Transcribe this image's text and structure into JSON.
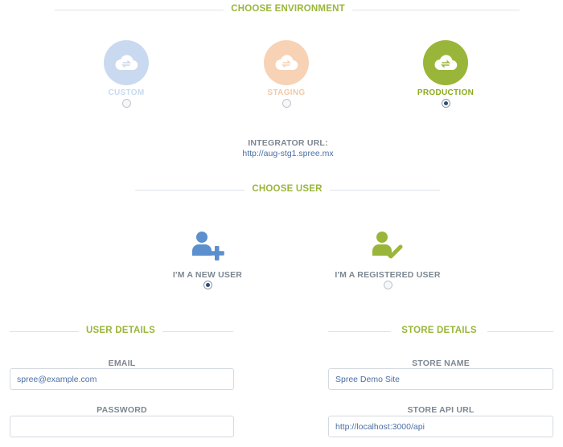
{
  "environment": {
    "heading": "CHOOSE ENVIRONMENT",
    "options": [
      {
        "label": "CUSTOM",
        "selected": false,
        "color": "#c9d9ef",
        "label_color": "#c9d9ef"
      },
      {
        "label": "STAGING",
        "selected": false,
        "color": "#f7d2b5",
        "label_color": "#f2c9a8"
      },
      {
        "label": "PRODUCTION",
        "selected": true,
        "color": "#9ab63a",
        "label_color": "#8aab1f"
      }
    ],
    "integrator_label": "INTEGRATOR URL:",
    "integrator_url": "http://aug-stg1.spree.mx"
  },
  "user_choice": {
    "heading": "CHOOSE USER",
    "options": [
      {
        "label": "I'M A NEW USER",
        "icon": "add-user-icon",
        "selected": true,
        "color": "#5b8fcd"
      },
      {
        "label": "I'M A REGISTERED USER",
        "icon": "verified-user-icon",
        "selected": false,
        "color": "#9ab63a"
      }
    ]
  },
  "user_details": {
    "heading": "USER DETAILS",
    "email_label": "EMAIL",
    "email_value": "spree@example.com",
    "password_label": "PASSWORD",
    "password_value": ""
  },
  "store_details": {
    "heading": "STORE DETAILS",
    "store_name_label": "STORE NAME",
    "store_name_value": "Spree Demo Site",
    "store_api_label": "STORE API URL",
    "store_api_value": "http://localhost:3000/api"
  },
  "colors": {
    "accent": "#9ab63a",
    "link": "#4a6fa5",
    "label": "#7d8791"
  }
}
